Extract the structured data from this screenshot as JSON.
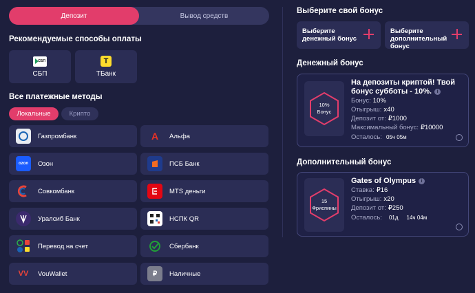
{
  "tabs": {
    "deposit": "Депозит",
    "withdraw": "Вывод средств"
  },
  "recommended": {
    "title": "Рекомендуемые способы оплаты",
    "items": [
      {
        "label": "СБП",
        "icon": "sbp-icon"
      },
      {
        "label": "ТБанк",
        "icon": "tbank-icon"
      }
    ]
  },
  "all_methods": {
    "title": "Все платежные методы",
    "filters": {
      "local": "Локальные",
      "crypto": "Крипто"
    },
    "items": [
      {
        "label": "Газпромбанк",
        "icon": "gazprombank-icon"
      },
      {
        "label": "Альфа",
        "icon": "alfa-icon"
      },
      {
        "label": "Озон",
        "icon": "ozon-icon"
      },
      {
        "label": "ПСБ Банк",
        "icon": "psb-icon"
      },
      {
        "label": "Совкомбанк",
        "icon": "sovcombank-icon"
      },
      {
        "label": "MTS деньги",
        "icon": "mts-icon"
      },
      {
        "label": "Уралсиб Банк",
        "icon": "uralsib-icon"
      },
      {
        "label": "НСПК QR",
        "icon": "qr-icon"
      },
      {
        "label": "Перевод на счет",
        "icon": "transfer-icon"
      },
      {
        "label": "Сбербанк",
        "icon": "sber-icon"
      },
      {
        "label": "VouWallet",
        "icon": "vouwallet-icon"
      },
      {
        "label": "Наличные",
        "icon": "cash-icon"
      }
    ]
  },
  "bonus": {
    "title": "Выберите свой бонус",
    "choose_money": "Выберите денежный бонус",
    "choose_extra": "Выберите дополнительный бонус",
    "money": {
      "title": "Денежный бонус",
      "badge_value": "10%",
      "badge_label": "Бонус",
      "headline": "На депозиты криптой! Твой бонус субботы - 10%.",
      "bonus_label": "Бонус:",
      "bonus_value": "10%",
      "wager_label": "Отыгрыш:",
      "wager_value": "x40",
      "deposit_label": "Депозит от:",
      "deposit_value": "₽1000",
      "max_label": "Максимальный бонус:",
      "max_value": "₽10000",
      "left_label": "Осталось:",
      "left_value": "05ч 05м"
    },
    "extra": {
      "title": "Дополнительный бонус",
      "badge_value": "15",
      "badge_label": "Фриспины",
      "headline": "Gates of Olympus",
      "bet_label": "Ставка:",
      "bet_value": "₽16",
      "wager_label": "Отыгрыш:",
      "wager_value": "x20",
      "deposit_label": "Депозит от:",
      "deposit_value": "₽250",
      "left_label": "Осталось:",
      "left_days": "01д",
      "left_time": "14ч 04м"
    }
  },
  "colors": {
    "accent": "#e23d6b",
    "background": "#1d1f3d",
    "card": "#2b2d55"
  }
}
